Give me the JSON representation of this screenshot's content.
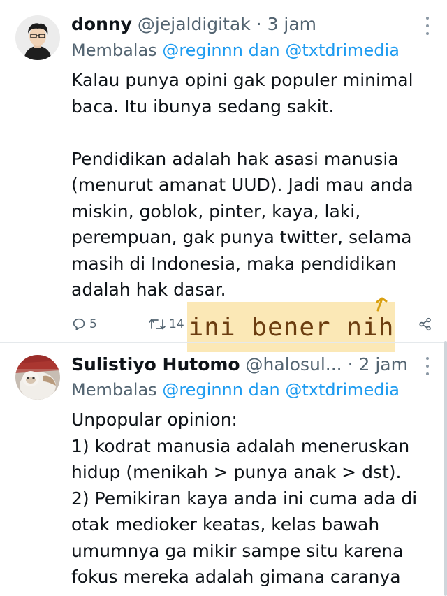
{
  "tweets": [
    {
      "author_name": "donny",
      "author_handle": "@jejaldigitak",
      "separator": "·",
      "time_ago": "3 jam",
      "reply_prefix": "Membalas",
      "reply_mentions": "@reginnn dan @txtdrimedia",
      "text": "Kalau punya opini gak populer minimal baca. Itu ibunya sedang sakit.\n\nPendidikan adalah hak asasi manusia (menurut amanat UUD). Jadi mau anda miskin, goblok, pinter, kaya, laki, perempuan, gak punya twitter, selama masih di Indonesia, maka pendidikan adalah hak dasar.",
      "reply_count": "5",
      "retweet_count": "14"
    },
    {
      "author_name": "Sulistiyo Hutomo",
      "author_handle": "@halosul...",
      "separator": "·",
      "time_ago": "2 jam",
      "reply_prefix": "Membalas",
      "reply_mentions": "@reginnn dan @txtdrimedia",
      "text": "Unpopular opinion:\n1) kodrat manusia adalah meneruskan hidup (menikah > punya anak > dst).\n2) Pemikiran kaya anda ini cuma ada di otak medioker keatas, kelas bawah umumnya ga mikir sampe situ karena fokus mereka adalah gimana caranya"
    }
  ],
  "sticker": {
    "text": "ini bener nih"
  },
  "colors": {
    "mention": "#1d9bf0",
    "muted": "#536471",
    "sticker_bg": "#fbe8b6"
  },
  "icons": [
    "more-icon",
    "reply-icon",
    "retweet-icon",
    "share-icon",
    "arrow-icon"
  ]
}
